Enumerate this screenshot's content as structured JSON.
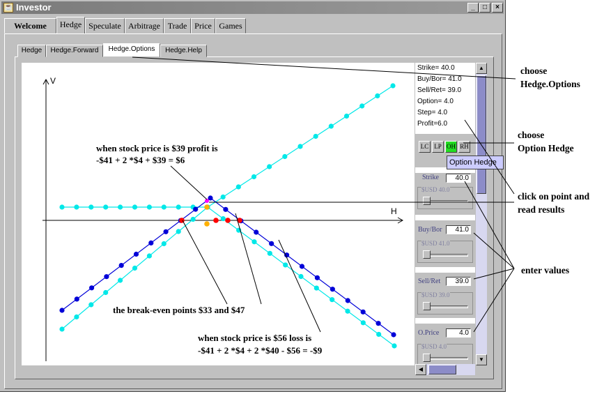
{
  "window": {
    "title": "Investor",
    "buttons": [
      "_",
      "□",
      "×"
    ]
  },
  "main_tabs": [
    {
      "label": "Welcome",
      "active": false
    },
    {
      "label": "Hedge",
      "active": true
    },
    {
      "label": "Speculate",
      "active": false
    },
    {
      "label": "Arbitrage",
      "active": false
    },
    {
      "label": "Trade",
      "active": false
    },
    {
      "label": "Price",
      "active": false
    },
    {
      "label": "Games",
      "active": false
    }
  ],
  "sub_tabs": [
    {
      "label": "Hedge",
      "active": false
    },
    {
      "label": "Hedge.Forward",
      "active": false
    },
    {
      "label": "Hedge.Options",
      "active": true
    },
    {
      "label": "Hedge.Help",
      "active": false
    }
  ],
  "info": {
    "strike": "Strike= 40.0",
    "buybor": "Buy/Bor= 41.0",
    "sellret": "Sell/Ret= 39.0",
    "option": "Option= 4.0",
    "step": "Step= 4.0",
    "profit": "Profit=6.0"
  },
  "mode_buttons": [
    {
      "label": "LC",
      "active": false
    },
    {
      "label": "LP",
      "active": false
    },
    {
      "label": "OH",
      "active": true
    },
    {
      "label": "RH",
      "active": false
    }
  ],
  "tooltip": "Option Hedge",
  "fields": {
    "strike": {
      "label": "Strike",
      "value": "40.0",
      "slider_label": "$USD 40.0"
    },
    "buybor": {
      "label": "Buy/Bor",
      "value": "41.0",
      "slider_label": "$USD 41.0"
    },
    "sellret": {
      "label": "Sell/Ret",
      "value": "39.0",
      "slider_label": "$USD 39.0"
    },
    "oprice": {
      "label": "O.Price",
      "value": "4.0",
      "slider_label": "$USD 4.0"
    }
  },
  "axes": {
    "v": "V",
    "h": "H"
  },
  "annotations": {
    "profit_line1": "when stock price is $39 profit is",
    "profit_line2": "-$41 + 2 *$4 + $39 = $6",
    "breakeven": "the break-even points $33 and $47",
    "loss_line1": "when stock price is $56 loss is",
    "loss_line2": "-$41 + 2 *$4 + 2 *$40 - $56 = -$9",
    "choose_options_1": "choose",
    "choose_options_2": "Hedge.Options",
    "choose_oh_1": "choose",
    "choose_oh_2": "Option Hedge",
    "click_1": "click on point and",
    "click_2": "read results",
    "enter_values": "enter values"
  },
  "colors": {
    "payoff_cyan": "#00e8e8",
    "payoff_blue": "#0000d8",
    "breakeven_red": "#ff0000",
    "marker_orange": "#ffb000",
    "marker_magenta": "#ff00ff",
    "active_mode": "#22dd22"
  },
  "chart_data": {
    "type": "line",
    "series": [
      {
        "color": "#00e8e8",
        "markers": "cyan dots"
      },
      {
        "color": "#0000d8",
        "markers": "blue dots"
      },
      {
        "color": "#00e8e8",
        "markers": "cyan dots"
      }
    ]
  }
}
